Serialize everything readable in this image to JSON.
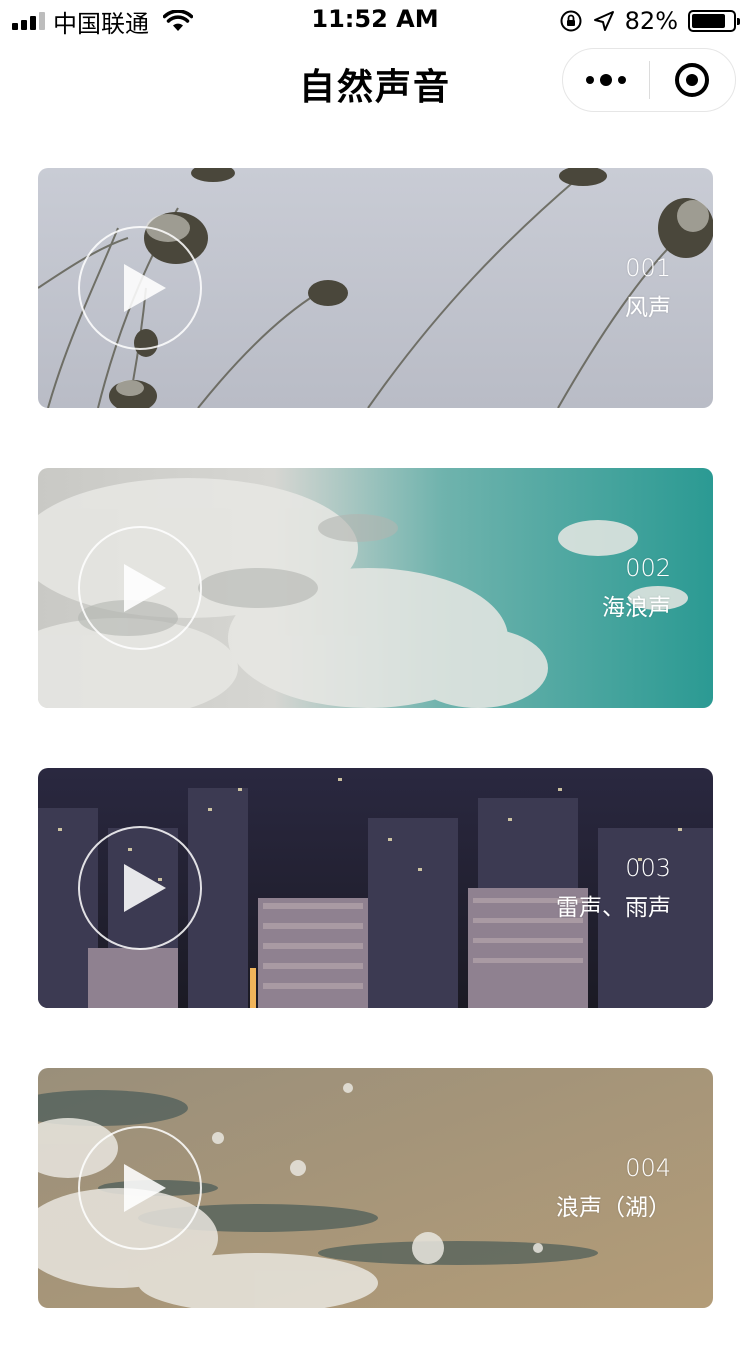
{
  "status_bar": {
    "carrier": "中国联通",
    "time": "11:52 AM",
    "battery_percent": "82%",
    "battery_level": 0.82,
    "icons": [
      "signal-icon",
      "wifi-icon",
      "orientation-lock-icon",
      "location-icon",
      "battery-icon"
    ]
  },
  "nav": {
    "title": "自然声音",
    "capsule_icons": [
      "more-icon",
      "close-miniprogram-icon"
    ]
  },
  "sounds": [
    {
      "number": "001",
      "name": "风声",
      "icon": "play-icon"
    },
    {
      "number": "002",
      "name": "海浪声",
      "icon": "play-icon"
    },
    {
      "number": "003",
      "name": "雷声、雨声",
      "icon": "play-icon"
    },
    {
      "number": "004",
      "name": "浪声（湖）",
      "icon": "play-icon"
    }
  ]
}
